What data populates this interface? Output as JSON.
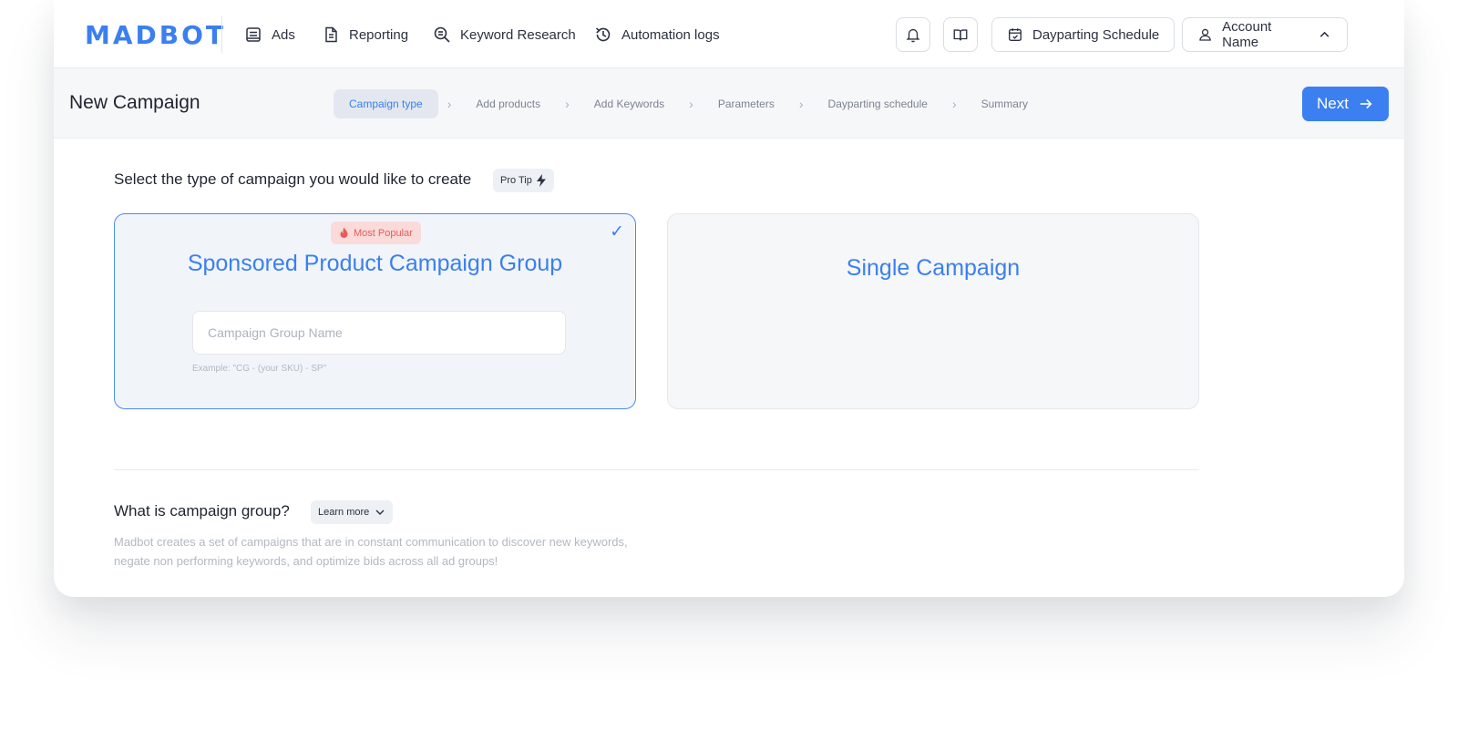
{
  "app": {
    "logo_text": "MADBOT"
  },
  "nav": {
    "items": [
      {
        "label": "Ads",
        "icon": "ads-icon"
      },
      {
        "label": "Reporting",
        "icon": "document-icon"
      },
      {
        "label": "Keyword Research",
        "icon": "search-icon"
      },
      {
        "label": "Automation logs",
        "icon": "history-icon"
      }
    ],
    "dayparting_label": "Dayparting Schedule",
    "account_label": "Account Name"
  },
  "header": {
    "title": "New Campaign",
    "steps": [
      "Campaign type",
      "Add products",
      "Add Keywords",
      "Parameters",
      "Dayparting schedule",
      "Summary"
    ],
    "active_step": 0,
    "next_label": "Next"
  },
  "main": {
    "question": "Select the type of campaign you would like to create",
    "protip_label": "Pro Tip",
    "cards": {
      "group": {
        "badge": "Most Popular",
        "title": "Sponsored Product Campaign Group",
        "input_value": "",
        "input_placeholder": "Campaign Group Name",
        "example": "Example: \"CG - (your SKU) - SP\""
      },
      "single": {
        "title": "Single Campaign"
      }
    },
    "what_title": "What is campaign group?",
    "learn_more_label": "Learn more",
    "description": "Madbot creates a set of campaigns that are in constant communication to discover new keywords, negate non performing keywords, and optimize bids across all ad groups!"
  },
  "colors": {
    "accent": "#3b7ff0",
    "badge_bg": "#fbdada",
    "badge_text": "#e85a5a"
  }
}
